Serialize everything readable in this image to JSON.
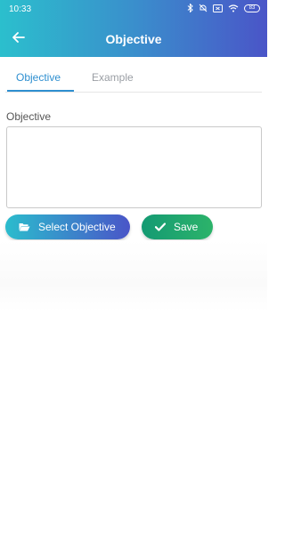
{
  "status_bar": {
    "time": "10:33",
    "battery": "83",
    "icons": [
      "bluetooth-icon",
      "mute-icon",
      "sim-icon",
      "wifi-icon",
      "battery-icon"
    ]
  },
  "header": {
    "title": "Objective",
    "back_icon": "arrow-left-icon",
    "gradient": [
      "#2bbfcd",
      "#4a55c8"
    ]
  },
  "tabs": [
    {
      "label": "Objective",
      "active": true
    },
    {
      "label": "Example",
      "active": false
    }
  ],
  "form": {
    "field_label": "Objective",
    "field_value": ""
  },
  "buttons": {
    "select_label": "Select Objective",
    "select_icon": "folder-open-icon",
    "save_label": "Save",
    "save_icon": "check-icon"
  },
  "colors": {
    "accent": "#2e8fd0",
    "save_green": "#1fa46e"
  }
}
